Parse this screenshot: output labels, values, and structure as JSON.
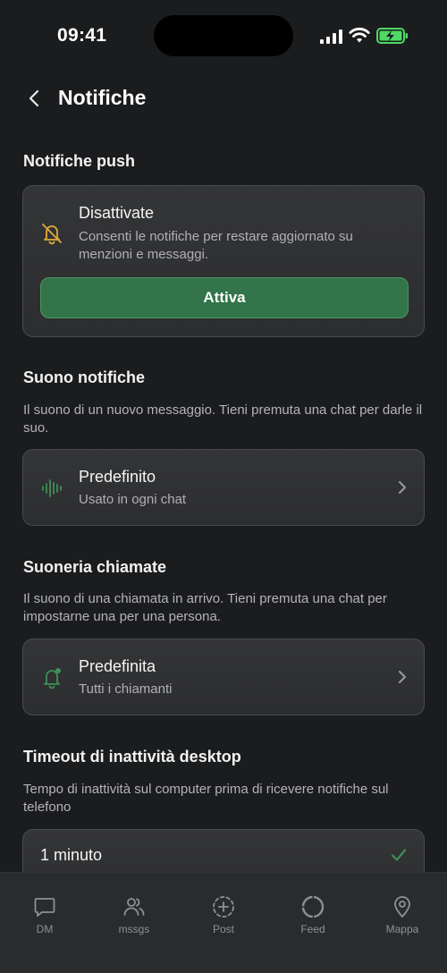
{
  "status": {
    "time": "09:41"
  },
  "header": {
    "title": "Notifiche"
  },
  "push": {
    "section_title": "Notifiche push",
    "state_title": "Disattivate",
    "state_desc": "Consenti le notifiche per restare aggiornato su menzioni e messaggi.",
    "button_label": "Attiva"
  },
  "sound": {
    "section_title": "Suono notifiche",
    "desc": "Il suono di un nuovo messaggio. Tieni premuta una chat per darle il suo.",
    "item_title": "Predefinito",
    "item_sub": "Usato in ogni chat"
  },
  "ringtone": {
    "section_title": "Suoneria chiamate",
    "desc": "Il suono di una chiamata in arrivo. Tieni premuta una chat per impostarne una per una persona.",
    "item_title": "Predefinita",
    "item_sub": "Tutti i chiamanti"
  },
  "timeout": {
    "section_title": "Timeout di inattività desktop",
    "desc": "Tempo di inattività sul computer prima di ricevere notifiche sul telefono",
    "selected_option": "1 minuto"
  },
  "tabs": [
    {
      "label": "DM",
      "icon": "chat-bubble-icon"
    },
    {
      "label": "mssgs",
      "icon": "people-icon"
    },
    {
      "label": "Post",
      "icon": "plus-circle-icon"
    },
    {
      "label": "Feed",
      "icon": "circle-icon"
    },
    {
      "label": "Mappa",
      "icon": "map-pin-icon"
    }
  ],
  "colors": {
    "background": "#1b1c1e",
    "accent_green": "#33744a",
    "icon_green": "#3f8f58",
    "bell_off_yellow": "#e0a93a",
    "battery_green": "#4cd964"
  }
}
